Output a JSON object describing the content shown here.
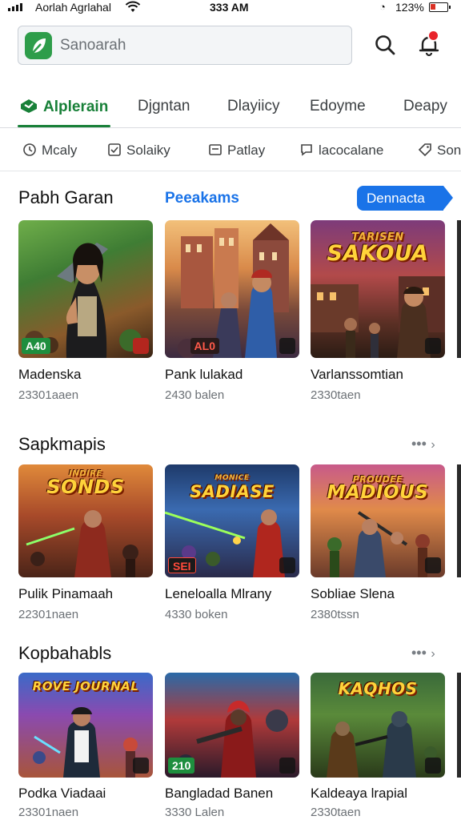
{
  "status_bar": {
    "carrier": "Aorlah Agrlahal",
    "time": "333 AM",
    "battery": "123%",
    "battery_level": 0.3
  },
  "search": {
    "placeholder": "Sanoarah",
    "search_icon": "search-icon",
    "notification_icon": "notification-bell-icon"
  },
  "tabs": [
    {
      "label": "Alplerain",
      "active": true,
      "icon": "game-controller-icon"
    },
    {
      "label": "Djgntan",
      "active": false
    },
    {
      "label": "Dlayiicy",
      "active": false
    },
    {
      "label": "Edoyme",
      "active": false
    },
    {
      "label": "Deapy",
      "active": false
    }
  ],
  "chips": [
    {
      "label": "Mcaly",
      "icon": "clock-icon"
    },
    {
      "label": "Solaiky",
      "icon": "check-square-icon"
    },
    {
      "label": "Patlay",
      "icon": "card-icon"
    },
    {
      "label": "lacocalane",
      "icon": "chat-icon"
    },
    {
      "label": "Son",
      "icon": "tag-icon"
    }
  ],
  "sections": [
    {
      "title": "Pabh Garan",
      "link": "Peeakams",
      "button": "Dennacta",
      "cards": [
        {
          "title": "Madenska",
          "subtitle": "23301aaen",
          "badge": "A40",
          "badge_style": "green"
        },
        {
          "title": "Pank lulakad",
          "subtitle": "2430 balen",
          "badge": "AL0",
          "badge_style": "dark"
        },
        {
          "title": "Varlanssomtian",
          "subtitle": "2330taen",
          "logo_text": "SAKOUA",
          "logo_top_text": "TARISEN"
        }
      ]
    },
    {
      "title": "Sapkmapis",
      "more": "•••",
      "cards": [
        {
          "title": "Pulik Pinamaah",
          "subtitle": "22301naen",
          "logo_text": "SONDS",
          "logo_top_text": "INDIRE"
        },
        {
          "title": "Leneloalla Mlrany",
          "subtitle": "4330 boken",
          "badge": "SEI",
          "badge_style": "dark",
          "logo_text": "SADIASE",
          "logo_top_text": "MONICE"
        },
        {
          "title": "Sobliae Slena",
          "subtitle": "2380tssn",
          "logo_text": "MADIOUS",
          "logo_top_text": "PROUDEE"
        }
      ]
    },
    {
      "title": "Kopbahabls",
      "more": "•••",
      "cards": [
        {
          "title": "Podka Viadaai",
          "subtitle": "23301naen",
          "logo_text": "ROVE JOURNAL",
          "logo_top_text": ""
        },
        {
          "title": "Bangladad Banen",
          "subtitle": "3330 Lalen",
          "badge": "210",
          "badge_style": "green"
        },
        {
          "title": "Kaldeaya lrapial",
          "subtitle": "2330taen",
          "logo_text": "KAQHOS",
          "logo_top_text": ""
        }
      ]
    }
  ],
  "colors": {
    "accent_green": "#188038",
    "link_blue": "#1a73e8",
    "notification_red": "#e8232b"
  }
}
